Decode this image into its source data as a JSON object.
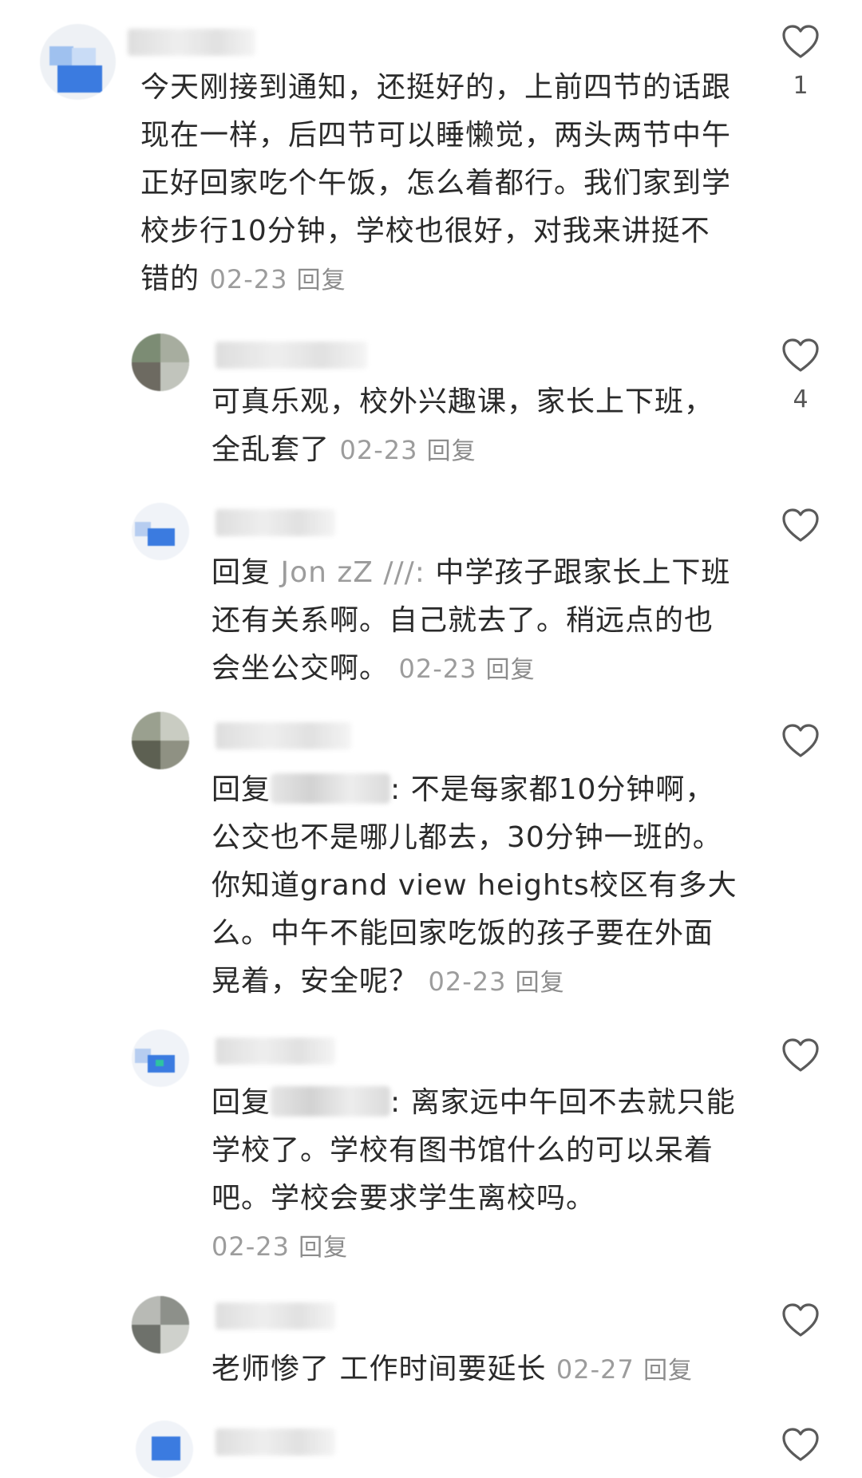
{
  "comments": [
    {
      "id": "c1",
      "text": "今天刚接到通知，还挺好的，上前四节的话跟现在一样，后四节可以睡懒觉，两头两节中午正好回家吃个午饭，怎么着都行。我们家到学校步行10分钟，学校也很好，对我来讲挺不错的",
      "date": "02-23",
      "reply_label": "回复",
      "likes": "1"
    },
    {
      "id": "c2",
      "text": "可真乐观，校外兴趣课，家长上下班，全乱套了",
      "date": "02-23",
      "reply_label": "回复",
      "likes": "4"
    },
    {
      "id": "c3",
      "reply_prefix": "回复",
      "mention": "Jon zZ  ///:",
      "text": " 中学孩子跟家长上下班还有关系啊。自己就去了。稍远点的也会坐公交啊。",
      "date": "02-23",
      "reply_label": "回复",
      "likes": ""
    },
    {
      "id": "c4",
      "reply_prefix": "回复",
      "text": ": 不是每家都10分钟啊，公交也不是哪儿都去，30分钟一班的。你知道grand view heights校区有多大么。中午不能回家吃饭的孩子要在外面晃着，安全呢？",
      "date": "02-23",
      "reply_label": "回复",
      "likes": ""
    },
    {
      "id": "c5",
      "reply_prefix": "回复",
      "text": ": 离家远中午回不去就只能学校了。学校有图书馆什么的可以呆着吧。学校会要求学生离校吗。",
      "date": "02-23",
      "reply_label": "回复",
      "likes": ""
    },
    {
      "id": "c6",
      "text": "老师惨了 工作时间要延长",
      "date": "02-27",
      "reply_label": "回复",
      "likes": ""
    }
  ],
  "colors": {
    "text": "#2a2a2a",
    "meta": "#9c9c9c",
    "heart": "#5a5a5a",
    "avatar_blue": "#3b7be0"
  },
  "icons": {
    "like": "heart-outline-icon"
  }
}
